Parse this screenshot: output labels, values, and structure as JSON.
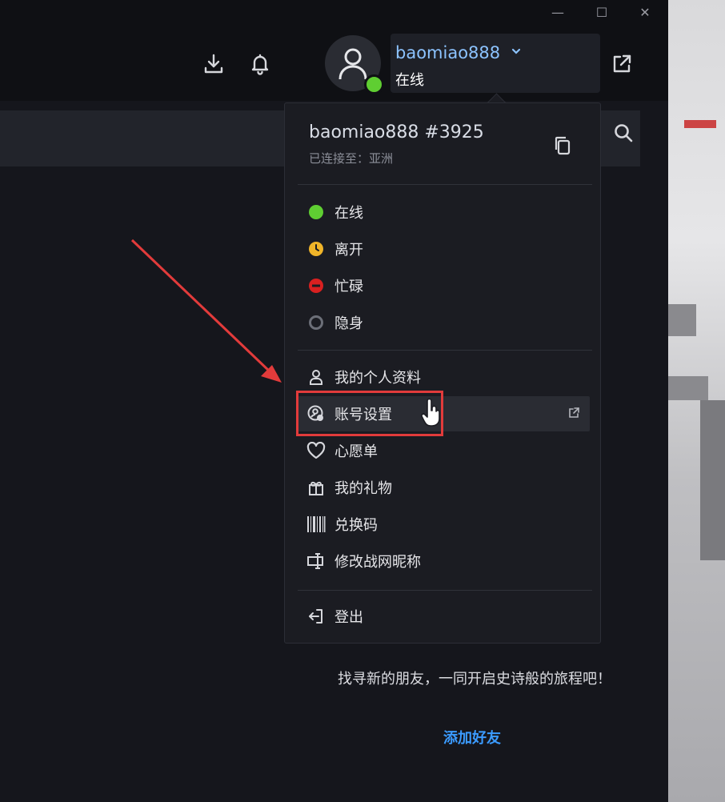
{
  "window": {
    "controls": {
      "minimize": "—",
      "maximize": "☐",
      "close": "✕"
    }
  },
  "header": {
    "username": "baomiao888",
    "status": "在线",
    "icons": [
      "download-icon",
      "bell-icon",
      "external-link-icon"
    ]
  },
  "dropdown": {
    "account_tag": "baomiao888 #3925",
    "region": "已连接至：亚洲",
    "statuses": [
      {
        "label": "在线",
        "color": "#5fce32"
      },
      {
        "label": "离开",
        "color": "#f0b429"
      },
      {
        "label": "忙碌",
        "color": "#d92020"
      },
      {
        "label": "隐身",
        "color": "#6c6f78"
      }
    ],
    "items": [
      {
        "label": "我的个人资料",
        "icon": "user-icon"
      },
      {
        "label": "账号设置",
        "icon": "account-settings-icon"
      },
      {
        "label": "心愿单",
        "icon": "heart-icon"
      },
      {
        "label": "我的礼物",
        "icon": "gift-icon"
      },
      {
        "label": "兑换码",
        "icon": "barcode-icon"
      },
      {
        "label": "修改战网昵称",
        "icon": "rename-icon"
      }
    ],
    "logout": "登出"
  },
  "friends": {
    "empty_message": "找寻新的朋友，一同开启史诗般的旅程吧！",
    "add_friend": "添加好友"
  },
  "colors": {
    "accent_blue": "#3b9bff",
    "username_blue": "#8cc3ff",
    "highlight_red": "#e23b3b"
  }
}
